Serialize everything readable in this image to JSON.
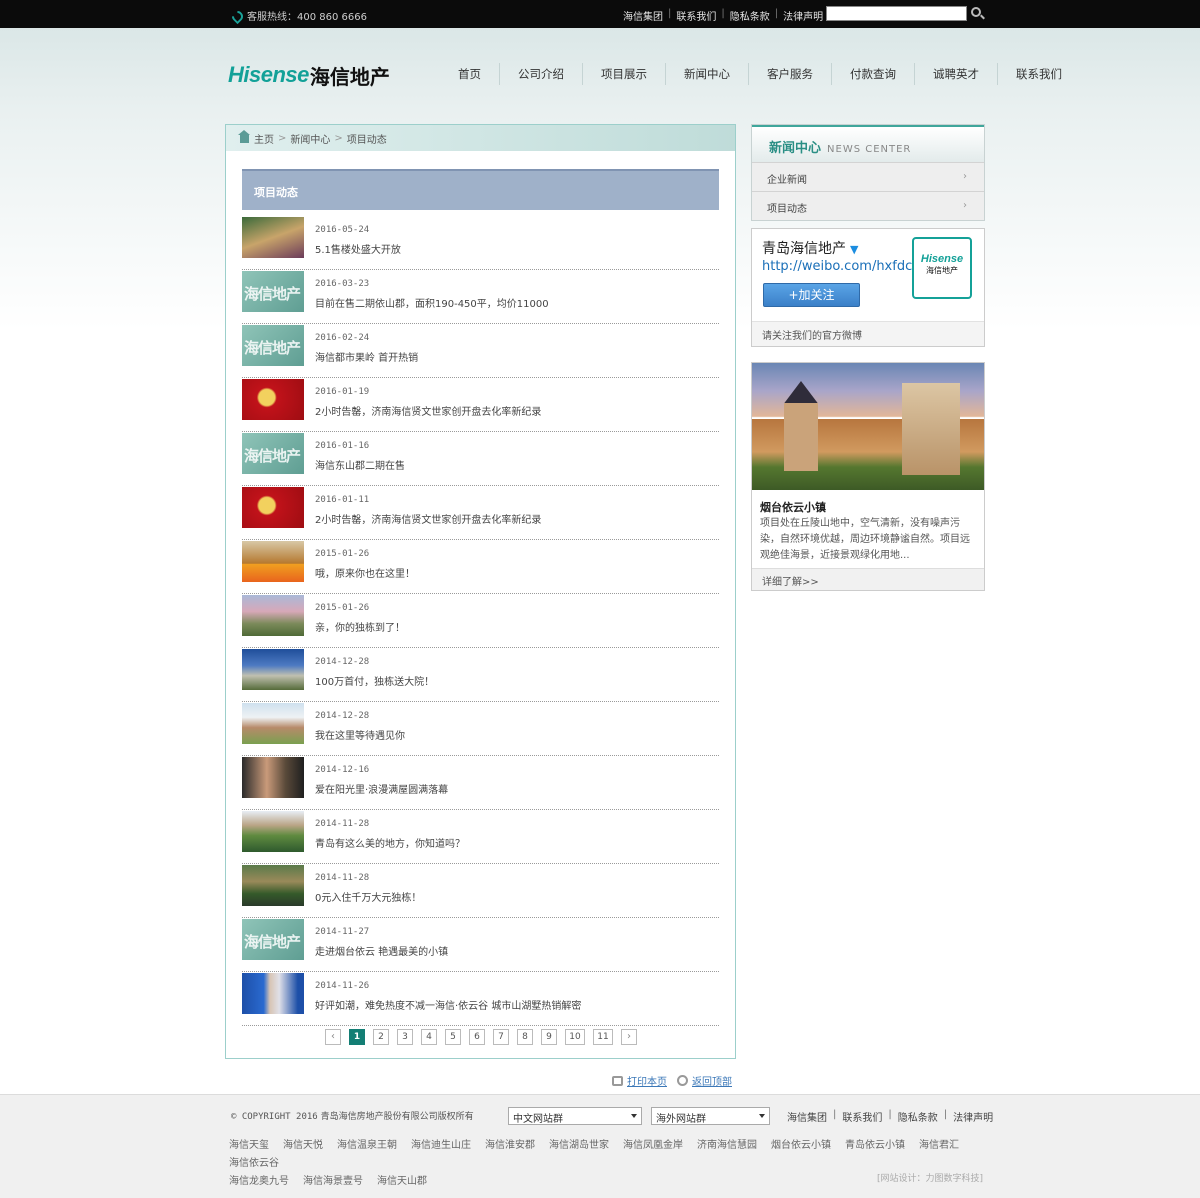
{
  "topbar": {
    "hotline": "客服热线：400 860 6666",
    "links": [
      "海信集团",
      "联系我们",
      "隐私条款",
      "法律声明"
    ],
    "search_value": ""
  },
  "header": {
    "logo_en": "Hisense",
    "logo_cn": "海信地产",
    "nav": [
      "首页",
      "公司介绍",
      "项目展示",
      "新闻中心",
      "客户服务",
      "付款查询",
      "诚聘英才",
      "联系我们"
    ]
  },
  "breadcrumb": [
    "主页",
    "新闻中心",
    "项目动态"
  ],
  "section_title": "项目动态",
  "news": [
    {
      "date": "2016-05-24",
      "title": "5.1售楼处盛大开放"
    },
    {
      "date": "2016-03-23",
      "title": "目前在售二期依山郡，面积190-450平，均价11000"
    },
    {
      "date": "2016-02-24",
      "title": "海信都市果岭 首开热销"
    },
    {
      "date": "2016-01-19",
      "title": "2小时告罄，济南海信贤文世家创开盘去化率新纪录"
    },
    {
      "date": "2016-01-16",
      "title": "海信东山郡二期在售"
    },
    {
      "date": "2016-01-11",
      "title": "2小时告罄，济南海信贤文世家创开盘去化率新纪录"
    },
    {
      "date": "2015-01-26",
      "title": "哦，原来你也在这里！"
    },
    {
      "date": "2015-01-26",
      "title": "亲，你的独栋到了！"
    },
    {
      "date": "2014-12-28",
      "title": "100万首付，独栋送大院！"
    },
    {
      "date": "2014-12-28",
      "title": "我在这里等待遇见你"
    },
    {
      "date": "2014-12-16",
      "title": "爱在阳光里·浪漫满屋圆满落幕"
    },
    {
      "date": "2014-11-28",
      "title": "青岛有这么美的地方，你知道吗？"
    },
    {
      "date": "2014-11-28",
      "title": "0元入住千万大元独栋！"
    },
    {
      "date": "2014-11-27",
      "title": "走进烟台依云 艳遇最美的小镇"
    },
    {
      "date": "2014-11-26",
      "title": "好评如潮，难免热度不减一海信·依云谷 城市山湖墅热销解密"
    }
  ],
  "pager": {
    "prev": "‹",
    "pages": [
      "1",
      "2",
      "3",
      "4",
      "5",
      "6",
      "7",
      "8",
      "9",
      "10",
      "11"
    ],
    "current": "1",
    "next": "›"
  },
  "sidebar": {
    "news_center_cn": "新闻中心",
    "news_center_en": "NEWS CENTER",
    "items": [
      "企业新闻",
      "项目动态"
    ],
    "weibo": {
      "name": "青岛海信地产",
      "url": "http://weibo.com/hxfdc",
      "follow": "+加关注",
      "logo_en": "Hisense",
      "logo_cn": "海信地产",
      "note": "请关注我们的官方微博"
    },
    "project": {
      "title": "烟台依云小镇",
      "desc": "项目处在丘陵山地中，空气清新，没有噪声污染，自然环境优越，周边环境静谧自然。项目远观绝佳海景，近接景观绿化用地...",
      "more": "详细了解>>"
    }
  },
  "util": {
    "print": "打印本页",
    "top": "返回顶部"
  },
  "footer": {
    "copyright_mono": "© COPYRIGHT 2016",
    "copyright_text": "青岛海信房地产股份有限公司版权所有",
    "select_cn": "中文网站群",
    "select_overseas": "海外网站群",
    "links": [
      "海信集团",
      "联系我们",
      "隐私条款",
      "法律声明"
    ],
    "projects": [
      "海信天玺",
      "海信天悦",
      "海信温泉王朝",
      "海信迪生山庄",
      "海信淮安郡",
      "海信湖岛世家",
      "海信凤凰金岸",
      "济南海信慧园",
      "烟台依云小镇",
      "青岛依云小镇",
      "海信君汇",
      "海信依云谷",
      "海信龙奥九号",
      "海信海景壹号",
      "海信天山郡"
    ],
    "design": "[网站设计：力图数字科技]"
  }
}
